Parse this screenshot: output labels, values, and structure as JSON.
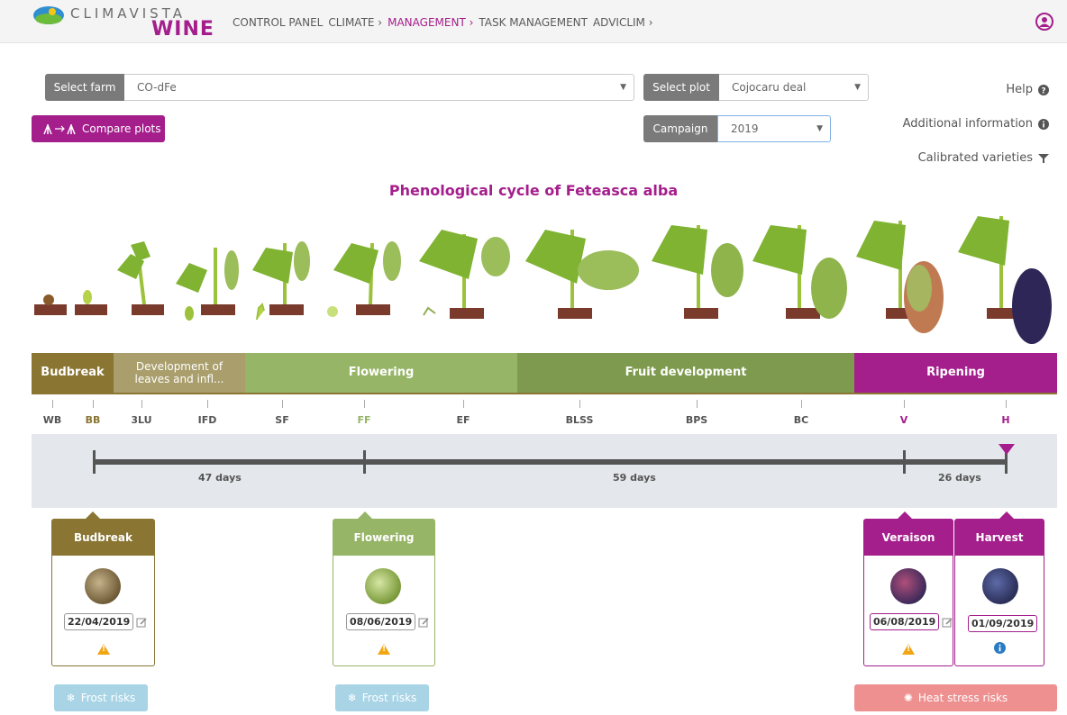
{
  "header": {
    "logo_top": "CLIMAVISTA",
    "logo_bottom": "WINE",
    "nav": [
      {
        "label": "CONTROL PANEL"
      },
      {
        "label": "CLIMATE ›"
      },
      {
        "label": "MANAGEMENT ›"
      },
      {
        "label": "TASK MANAGEMENT"
      },
      {
        "label": "ADVICLIM ›"
      }
    ]
  },
  "filters": {
    "farm_label": "Select farm",
    "farm_value": "CO-dFe",
    "plot_label": "Select plot",
    "plot_value": "Cojocaru deal",
    "campaign_label": "Campaign",
    "campaign_value": "2019",
    "compare_label": "Compare plots"
  },
  "links": {
    "help": "Help",
    "additional": "Additional information",
    "calibrated": "Calibrated varieties"
  },
  "title": "Phenological cycle of Feteasca alba",
  "stages": [
    {
      "label": "Budbreak",
      "color": "#8a7533"
    },
    {
      "label": "Development of leaves and infl...",
      "color": "#a99e6c"
    },
    {
      "label": "Flowering",
      "color": "#97b567"
    },
    {
      "label": "Fruit development",
      "color": "#7d9a4e"
    },
    {
      "label": "Ripening",
      "color": "#a41e8c"
    }
  ],
  "codes": [
    {
      "code": "WB",
      "color": "#555"
    },
    {
      "code": "BB",
      "color": "#8a7533"
    },
    {
      "code": "3LU",
      "color": "#555"
    },
    {
      "code": "IFD",
      "color": "#555"
    },
    {
      "code": "SF",
      "color": "#555"
    },
    {
      "code": "FF",
      "color": "#97b567"
    },
    {
      "code": "EF",
      "color": "#555"
    },
    {
      "code": "BLSS",
      "color": "#555"
    },
    {
      "code": "BPS",
      "color": "#555"
    },
    {
      "code": "BC",
      "color": "#555"
    },
    {
      "code": "V",
      "color": "#a41e8c"
    },
    {
      "code": "H",
      "color": "#a41e8c"
    }
  ],
  "timeline": {
    "segments": [
      {
        "label": "47 days"
      },
      {
        "label": "59 days"
      },
      {
        "label": "26 days"
      }
    ]
  },
  "cards": [
    {
      "title": "Budbreak",
      "date": "22/04/2019",
      "color": "#8a7533",
      "status_icon": "warning-icon"
    },
    {
      "title": "Flowering",
      "date": "08/06/2019",
      "color": "#97b567",
      "status_icon": "warning-icon"
    },
    {
      "title": "Veraison",
      "date": "06/08/2019",
      "color": "#a41e8c",
      "status_icon": "warning-icon"
    },
    {
      "title": "Harvest",
      "date": "01/09/2019",
      "color": "#a41e8c",
      "status_icon": "info-icon"
    }
  ],
  "risks": [
    {
      "label": "Frost risks",
      "color": "#a8d4e6"
    },
    {
      "label": "Frost risks",
      "color": "#a8d4e6"
    },
    {
      "label": "Heat stress risks",
      "color": "#ee9090"
    }
  ]
}
